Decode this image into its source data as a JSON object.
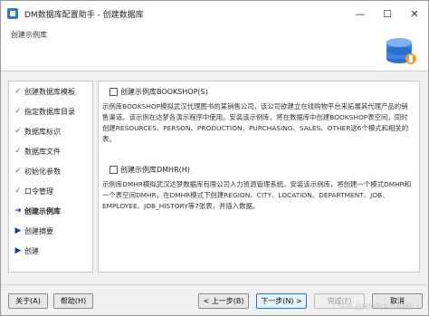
{
  "window": {
    "title": "DM数据库配置助手 - 创建数据库",
    "controls": [
      "minimize-icon",
      "maximize-icon",
      "close-icon"
    ]
  },
  "header": {
    "title": "创建示例库"
  },
  "sidebar": {
    "steps": [
      {
        "label": "创建数据库模板",
        "state": "done"
      },
      {
        "label": "指定数据库目录",
        "state": "done"
      },
      {
        "label": "数据库标识",
        "state": "done"
      },
      {
        "label": "数据库文件",
        "state": "done"
      },
      {
        "label": "初始化参数",
        "state": "done"
      },
      {
        "label": "口令管理",
        "state": "done"
      },
      {
        "label": "创建示例库",
        "state": "current"
      },
      {
        "label": "创建摘要",
        "state": "pending"
      },
      {
        "label": "创建",
        "state": "pending"
      }
    ]
  },
  "content": {
    "bookshop": {
      "label": "创建示例库BOOKSHOP(S)",
      "checked": false,
      "description": "示例库BOOKSHOP模拟武汉代理图书的某销售公司，该公司欲建立在线购物平台来拓展其代理产品的销售渠道。该示例在达梦各演示程序中使用。安装该示例库，将在数据库中创建BOOKSHOP表空间，同时创建RESOURCES、PERSON、PRODUCTION、PURCHASING、SALES、OTHER这6个模式和相关的表。"
    },
    "dmhr": {
      "label": "创建示例库DMHR(H)",
      "checked": false,
      "description": "示例库DMHR模拟武汉达梦数据库有限公司人力资源管理系统。安装该示例库，将创建一个模式DMHR和一个表空间DMHR，在DMHR模式下创建REGION、CITY、LOCATION、DEPARTMENT、JOB、EMPLOYEE、JOB_HISTORY等7张表，并插入数据。"
    }
  },
  "footer": {
    "about": "关于(A)",
    "help": "帮助(H)",
    "prev": "< 上一步(B)",
    "next": "下一步(N) >",
    "finish": "完成(F)",
    "cancel": "取消"
  },
  "watermark": "CSDN @保护我方发际线！！"
}
